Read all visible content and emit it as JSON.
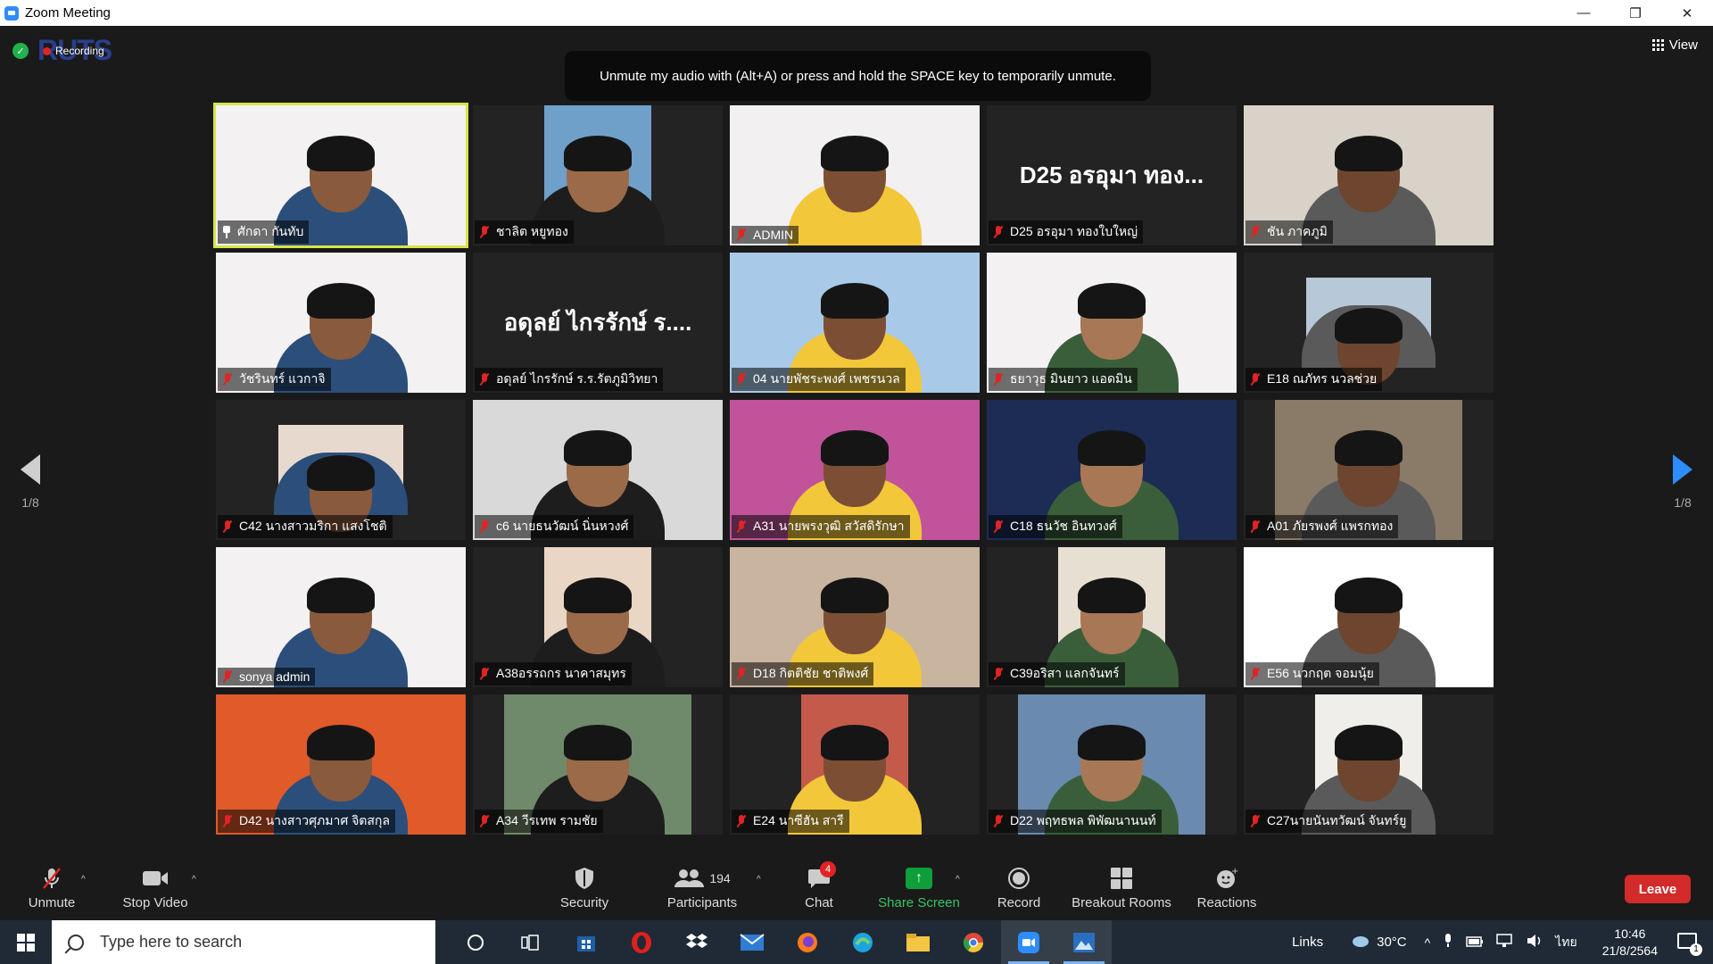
{
  "window": {
    "title": "Zoom Meeting",
    "minimize": "—",
    "restore": "❐",
    "close": "✕"
  },
  "top": {
    "recording_label": "Recording",
    "logo_text": "RUTS",
    "view_label": "View",
    "tooltip": "Unmute my audio with (Alt+A) or press and hold the SPACE key to temporarily unmute."
  },
  "pager": {
    "prev": "1/8",
    "next": "1/8"
  },
  "participants": [
    {
      "name": "ศักดา  กันทับ",
      "icon": "pin-icon",
      "bg": "#f4f1f2",
      "video": "full",
      "active": true
    },
    {
      "name": "ชาลิต หยูทอง",
      "icon": "mic-muted-icon",
      "bg": "#6fa0c9",
      "video": "narrow"
    },
    {
      "name": "ADMIN",
      "icon": "mic-muted-icon",
      "bg": "#f2f0f0",
      "video": "full"
    },
    {
      "name": "D25 อรอุมา  ทองใบใหญ่",
      "icon": "mic-muted-icon",
      "bg": "#232323",
      "video": "none",
      "display_text": "D25 อรอุมา  ทอง..."
    },
    {
      "name": "ชัน ภาคภูมิ",
      "icon": "mic-muted-icon",
      "bg": "#d8d2c8",
      "video": "full"
    },
    {
      "name": "วัชรินทร์ แวกาจิ",
      "icon": "mic-muted-icon",
      "bg": "#f4f1f2",
      "video": "full"
    },
    {
      "name": "อดุลย์ ไกรรักษ์ ร.ร.รัตภูมิวิทยา",
      "icon": "mic-muted-icon",
      "bg": "#232323",
      "video": "none",
      "display_text": "อดุลย์ ไกรรักษ์ ร...."
    },
    {
      "name": "04 นายพัชระพงศ์ เพชรนวล",
      "icon": "mic-muted-icon",
      "bg": "#a9c9e8",
      "video": "full"
    },
    {
      "name": "ธยาวุธ มินยาว แอดมิน",
      "icon": "mic-muted-icon",
      "bg": "#f4f1f2",
      "video": "full"
    },
    {
      "name": "E18 ณภัทร นวลช่วย",
      "icon": "mic-muted-icon",
      "bg": "#b7c8d8",
      "video": "small"
    },
    {
      "name": "C42 นางสาวมริกา แสงโชติ",
      "icon": "mic-muted-icon",
      "bg": "#e8d9cf",
      "video": "small"
    },
    {
      "name": "c6 นายธนวัฒน์ นิ่นหวงศ์",
      "icon": "mic-muted-icon",
      "bg": "#d9d9d9",
      "video": "full"
    },
    {
      "name": "A31 นายพรงวุฒิ สวัสดิรักษา",
      "icon": "mic-muted-icon",
      "bg": "#c0539a",
      "video": "full"
    },
    {
      "name": "C18 ธนวัช อินทวงศ์",
      "icon": "mic-muted-icon",
      "bg": "#1c2c55",
      "video": "full"
    },
    {
      "name": "A01 ภัยรพงศ์ แพรกทอง",
      "icon": "mic-muted-icon",
      "bg": "#8a7a68",
      "video": "mid"
    },
    {
      "name": "sonya admin",
      "icon": "mic-muted-icon",
      "bg": "#f4f1f2",
      "video": "full"
    },
    {
      "name": "A38อรรถกร นาคาสมุทร",
      "icon": "mic-muted-icon",
      "bg": "#e9d6c4",
      "video": "narrow"
    },
    {
      "name": "D18 กิตติชัย ชาติพงศ์",
      "icon": "mic-muted-icon",
      "bg": "#c9b4a0",
      "video": "full"
    },
    {
      "name": "C39อริสา แลกจันทร์",
      "icon": "mic-muted-icon",
      "bg": "#e8dfd3",
      "video": "narrow"
    },
    {
      "name": "E56 นวกฤต จอมนุ้ย",
      "icon": "mic-muted-icon",
      "bg": "#ffffff",
      "video": "full"
    },
    {
      "name": "D42 นางสาวศุภมาศ จิตสกุล",
      "icon": "mic-muted-icon",
      "bg": "#e05a2a",
      "video": "full"
    },
    {
      "name": "A34  วีรเทพ   รามชัย",
      "icon": "mic-muted-icon",
      "bg": "#6f8a6a",
      "video": "mid"
    },
    {
      "name": "E24 นาซีฮัน สารี",
      "icon": "mic-muted-icon",
      "bg": "#c45a4a",
      "video": "narrow"
    },
    {
      "name": "D22 พฤทธพล พิพัฒนานนท์",
      "icon": "mic-muted-icon",
      "bg": "#6a8ab0",
      "video": "mid"
    },
    {
      "name": "C27นายนันทวัฒน์ จันทร์ยู",
      "icon": "mic-muted-icon",
      "bg": "#f0eeea",
      "video": "narrow"
    }
  ],
  "toolbar": {
    "unmute": "Unmute",
    "stop_video": "Stop Video",
    "security": "Security",
    "participants": "Participants",
    "participants_count": "194",
    "chat": "Chat",
    "chat_badge": "4",
    "share_screen": "Share Screen",
    "record": "Record",
    "breakout": "Breakout Rooms",
    "reactions": "Reactions",
    "leave": "Leave",
    "caret": "^"
  },
  "taskbar": {
    "search_placeholder": "Type here to search",
    "apps": [
      "cortana-icon",
      "task-view-icon",
      "store-icon",
      "opera-icon",
      "dropbox-icon",
      "mail-icon",
      "firefox-icon",
      "edge-icon",
      "file-explorer-icon",
      "chrome-icon",
      "zoom-icon",
      "photos-icon"
    ],
    "links": "Links",
    "temperature": "30°C",
    "language": "ไทย",
    "time": "10:46",
    "date": "21/8/2564",
    "notification_count": "1"
  },
  "colors": {
    "active_speaker": "#d6e44a",
    "leave": "#d32a2a",
    "share": "#0e9f3b",
    "accent": "#2d8cff"
  }
}
